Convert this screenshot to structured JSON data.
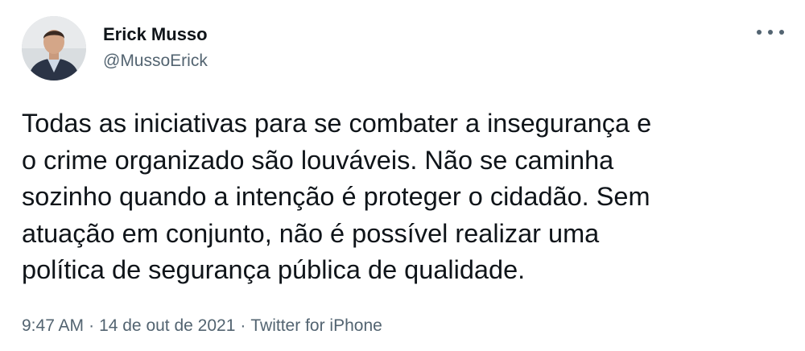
{
  "author": {
    "name": "Erick Musso",
    "handle": "@MussoErick"
  },
  "tweet": {
    "text": "Todas as iniciativas para se combater a insegurança e\no crime organizado são louváveis. Não se caminha\nsozinho quando a intenção é proteger o cidadão. Sem\natuação em conjunto, não é possível realizar uma\npolítica de segurança pública de qualidade."
  },
  "meta": {
    "time": "9:47 AM",
    "separator": "·",
    "date": "14 de out de 2021",
    "source": "Twitter for iPhone"
  },
  "icons": {
    "more": "more-horizontal-icon"
  },
  "colors": {
    "text_primary": "#0f1419",
    "text_secondary": "#536471",
    "background": "#ffffff"
  }
}
